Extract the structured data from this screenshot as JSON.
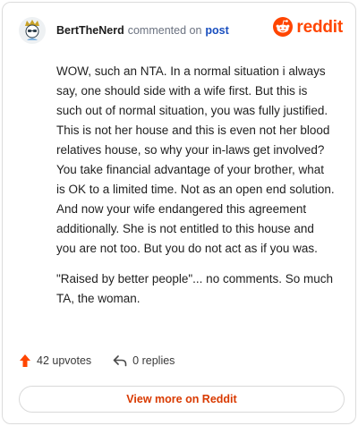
{
  "header": {
    "username": "BertTheNerd",
    "action_text": "commented on",
    "link_text": "post",
    "brand_name": "reddit"
  },
  "comment": {
    "paragraphs": [
      "WOW, such an NTA. In a normal situation i always say, one should side with a wife first. But this is such out of normal situation, you was fully justified. This is not her house and this is even not her blood relatives house, so why your in-laws get involved? You take financial advantage of your brother, what is OK to a limited time. Not as an open end solution. And now your wife endangered this agreement additionally. She is not entitled to this house and you are not too. But you do not act as if you was.",
      "\"Raised by better people\"... no comments. So much TA, the woman."
    ]
  },
  "footer": {
    "upvotes_label": "42 upvotes",
    "replies_label": "0 replies",
    "view_more_label": "View more on Reddit"
  },
  "colors": {
    "brand": "#ff4500",
    "link": "#1a4fbf",
    "view_more_text": "#d93a00"
  },
  "icons": {
    "avatar": "avatar-icon",
    "brand": "reddit-logo-icon",
    "upvote": "upvote-arrow-icon",
    "reply": "reply-arrow-icon"
  }
}
